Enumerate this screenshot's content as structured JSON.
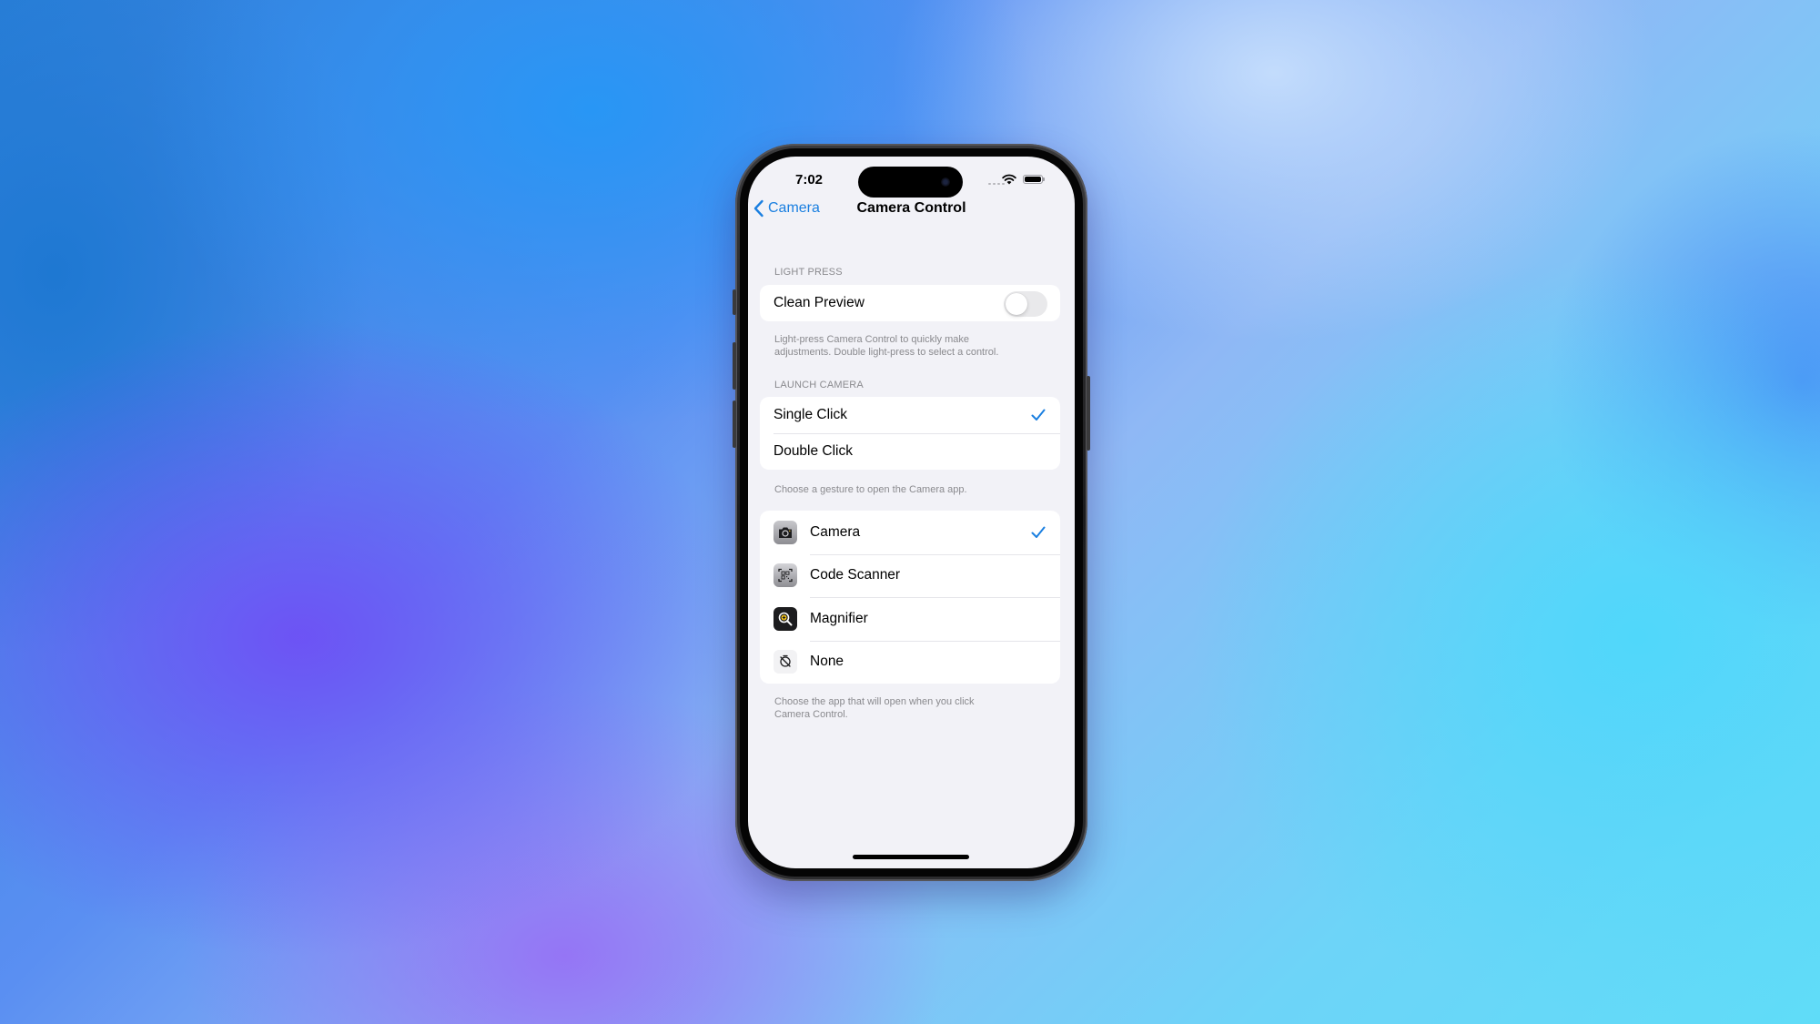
{
  "status_bar": {
    "time": "7:02"
  },
  "nav": {
    "back_label": "Camera",
    "title": "Camera Control"
  },
  "sections": {
    "light_press": {
      "header": "LIGHT PRESS",
      "rows": [
        {
          "label": "Clean Preview",
          "toggle_on": false
        }
      ],
      "footer_line1": "Light-press Camera Control to quickly make",
      "footer_line2": "adjustments. Double light-press to select a control."
    },
    "launch_camera": {
      "header": "LAUNCH CAMERA",
      "rows": [
        {
          "label": "Single Click",
          "selected": true
        },
        {
          "label": "Double Click",
          "selected": false
        }
      ],
      "footer": "Choose a gesture to open the Camera app."
    },
    "app_choice": {
      "rows": [
        {
          "label": "Camera",
          "icon": "camera-icon",
          "selected": true
        },
        {
          "label": "Code Scanner",
          "icon": "qr-code-scanner-icon",
          "selected": false
        },
        {
          "label": "Magnifier",
          "icon": "magnifier-icon",
          "selected": false
        },
        {
          "label": "None",
          "icon": "none-slash-icon",
          "selected": false
        }
      ],
      "footer_line1": "Choose the app that will open when you click",
      "footer_line2": "Camera Control."
    }
  },
  "colors": {
    "accent": "#1a7fe0",
    "screen_background": "#f2f2f7",
    "secondary_text": "#8a8a8e",
    "toggle_off": "#e9e9eb"
  }
}
